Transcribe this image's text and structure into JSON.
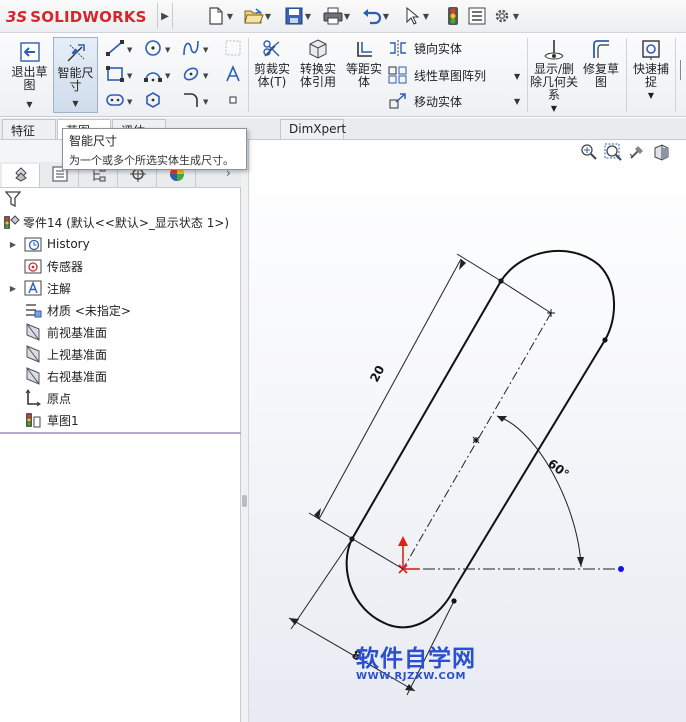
{
  "app": {
    "brand_prefix": "3S",
    "brand_name": "SOLIDWORKS"
  },
  "quick_access": [
    {
      "icon": "new-document-icon"
    },
    {
      "icon": "open-folder-icon"
    },
    {
      "icon": "save-icon"
    },
    {
      "icon": "print-icon"
    },
    {
      "icon": "undo-icon"
    },
    {
      "icon": "select-arrow-icon"
    },
    {
      "icon": "rebuild-traffic-light-icon"
    },
    {
      "icon": "file-properties-icon"
    },
    {
      "icon": "options-gear-icon"
    }
  ],
  "ribbon": {
    "exit_sketch": "退出草图",
    "smart_dimension": "智能尺寸",
    "trim_entities": "剪裁实体(T)",
    "convert_entities": "转换实体引用",
    "offset_entities": "等距实体",
    "mirror_entities": "镜向实体",
    "linear_pattern": "线性草图阵列",
    "move_entities": "移动实体",
    "display_delete_relations": "显示/删除几何关系",
    "repair_sketch": "修复草图",
    "quick_snaps": "快速捕捉"
  },
  "tabs": [
    {
      "label": "特征"
    },
    {
      "label": "草图"
    },
    {
      "label": "评估"
    },
    {
      "label": "DimXpert"
    }
  ],
  "tooltip": {
    "title": "智能尺寸",
    "description": "为一个或多个所选实体生成尺寸。"
  },
  "tree": {
    "root": "零件14  (默认<<默认>_显示状态 1>)",
    "items": [
      {
        "label": "History",
        "icon": "history-folder-icon",
        "expandable": true
      },
      {
        "label": "传感器",
        "icon": "sensor-icon",
        "expandable": false
      },
      {
        "label": "注解",
        "icon": "annotation-icon",
        "expandable": true
      },
      {
        "label": "材质 <未指定>",
        "icon": "material-icon",
        "expandable": false
      },
      {
        "label": "前视基准面",
        "icon": "plane-icon",
        "expandable": false
      },
      {
        "label": "上视基准面",
        "icon": "plane-icon",
        "expandable": false
      },
      {
        "label": "右视基准面",
        "icon": "plane-icon",
        "expandable": false
      },
      {
        "label": "原点",
        "icon": "origin-icon",
        "expandable": false
      },
      {
        "label": "草图1",
        "icon": "sketch-icon",
        "expandable": false
      }
    ]
  },
  "sketch": {
    "dim_length": "20",
    "dim_width": "8",
    "dim_angle": "60°",
    "colors": {
      "geometry": "#000000",
      "origin": "#e0201c",
      "endpoint": "#1010ff"
    }
  },
  "watermark": {
    "line1": "软件自学网",
    "line2": "WWW.RJZXW.COM"
  },
  "colors": {
    "brand": "#d6262c",
    "watermark": "#2a4fd0"
  }
}
